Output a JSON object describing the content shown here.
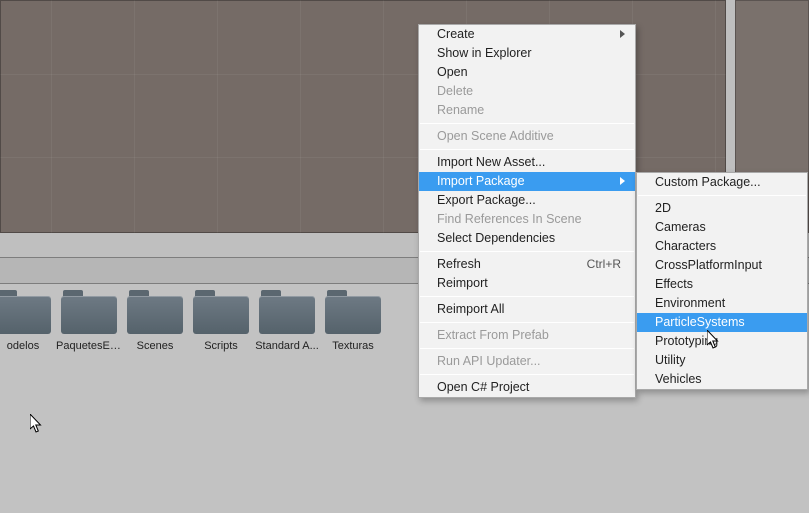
{
  "folders": [
    {
      "label": "odelos"
    },
    {
      "label": "PaquetesEx..."
    },
    {
      "label": "Scenes"
    },
    {
      "label": "Scripts"
    },
    {
      "label": "Standard A..."
    },
    {
      "label": "Texturas"
    }
  ],
  "context_menu": {
    "create": {
      "label": "Create"
    },
    "show_in_explorer": {
      "label": "Show in Explorer"
    },
    "open": {
      "label": "Open"
    },
    "delete": {
      "label": "Delete"
    },
    "rename": {
      "label": "Rename"
    },
    "open_scene_additive": {
      "label": "Open Scene Additive"
    },
    "import_new_asset": {
      "label": "Import New Asset..."
    },
    "import_package": {
      "label": "Import Package"
    },
    "export_package": {
      "label": "Export Package..."
    },
    "find_refs": {
      "label": "Find References In Scene"
    },
    "select_deps": {
      "label": "Select Dependencies"
    },
    "refresh": {
      "label": "Refresh",
      "shortcut": "Ctrl+R"
    },
    "reimport": {
      "label": "Reimport"
    },
    "reimport_all": {
      "label": "Reimport All"
    },
    "extract_prefab": {
      "label": "Extract From Prefab"
    },
    "run_api_updater": {
      "label": "Run API Updater..."
    },
    "open_csharp": {
      "label": "Open C# Project"
    }
  },
  "submenu": {
    "custom": {
      "label": "Custom Package..."
    },
    "two_d": {
      "label": "2D"
    },
    "cameras": {
      "label": "Cameras"
    },
    "characters": {
      "label": "Characters"
    },
    "crossplatform": {
      "label": "CrossPlatformInput"
    },
    "effects": {
      "label": "Effects"
    },
    "environment": {
      "label": "Environment"
    },
    "particlesystems": {
      "label": "ParticleSystems"
    },
    "prototyping": {
      "label": "Prototyping"
    },
    "utility": {
      "label": "Utility"
    },
    "vehicles": {
      "label": "Vehicles"
    }
  }
}
